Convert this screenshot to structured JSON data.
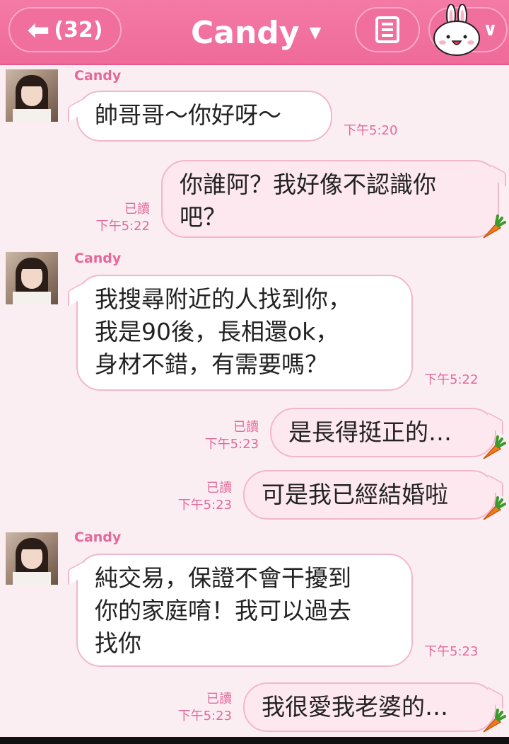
{
  "header": {
    "back_label": "(32)",
    "title": "Candy",
    "back_icon": "arrow-left-icon",
    "menu_icon": "list-menu-icon",
    "sticker_icon": "bunny-sticker-icon",
    "accent_color": "#f06f9c"
  },
  "messages": [
    {
      "side": "in",
      "sender": "Candy",
      "text": "帥哥哥～你好呀～",
      "time": "下午5:20"
    },
    {
      "side": "out",
      "read": "已讀",
      "text_lines": [
        "你誰阿？我好像不認識你",
        "吧？"
      ],
      "time": "下午5:22"
    },
    {
      "side": "in",
      "sender": "Candy",
      "text_lines": [
        "我搜尋附近的人找到你，",
        "我是90後，長相還ok，",
        "身材不錯，有需要嗎？"
      ],
      "time": "下午5:22"
    },
    {
      "side": "out",
      "read": "已讀",
      "text": "是長得挺正的…",
      "time": "下午5:23"
    },
    {
      "side": "out",
      "read": "已讀",
      "text": "可是我已經結婚啦",
      "time": "下午5:23"
    },
    {
      "side": "in",
      "sender": "Candy",
      "text_lines": [
        "純交易，保證不會干擾到",
        "你的家庭唷！我可以過去",
        "找你"
      ],
      "time": "下午5:23"
    },
    {
      "side": "out",
      "read": "已讀",
      "text": "我很愛我老婆的…",
      "time": "下午5:23"
    }
  ]
}
